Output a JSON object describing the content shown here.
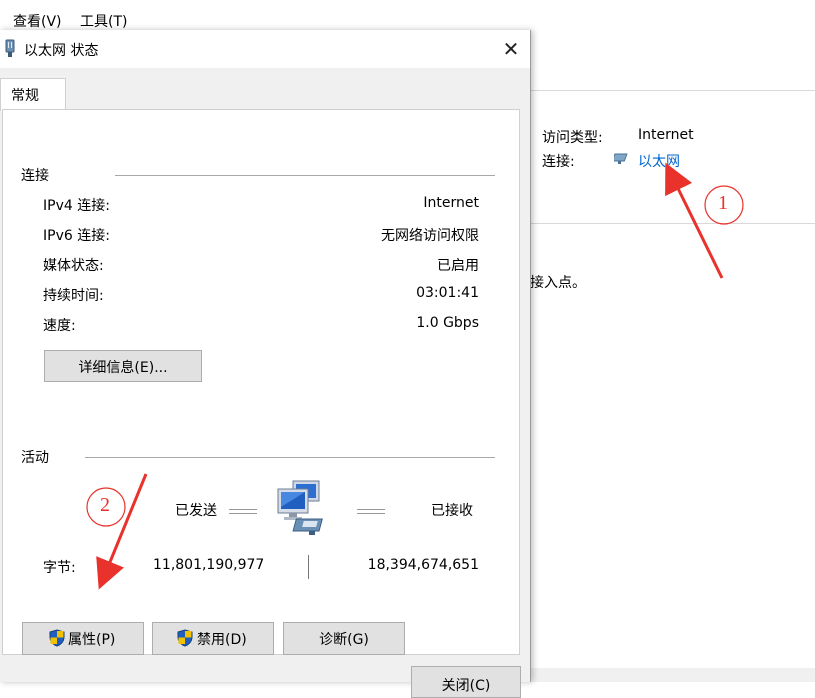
{
  "menu": {
    "view": "查看(V)",
    "tools": "工具(T)"
  },
  "background": {
    "access_type_label": "访问类型:",
    "access_type_value": "Internet",
    "connection_label": "连接:",
    "connection_link": "以太网",
    "partial_text": "接入点。"
  },
  "dialog": {
    "title": "以太网 状态",
    "tab": "常规",
    "connection_section": "连接",
    "rows": [
      {
        "label": "IPv4 连接:",
        "value": "Internet"
      },
      {
        "label": "IPv6 连接:",
        "value": "无网络访问权限"
      },
      {
        "label": "媒体状态:",
        "value": "已启用"
      },
      {
        "label": "持续时间:",
        "value": "03:01:41"
      },
      {
        "label": "速度:",
        "value": "1.0 Gbps"
      }
    ],
    "details_button": "详细信息(E)...",
    "activity_section": "活动",
    "sent_label": "已发送",
    "received_label": "已接收",
    "bytes_label": "字节:",
    "bytes_sent": "11,801,190,977",
    "bytes_received": "18,394,674,651",
    "properties_button": "属性(P)",
    "disable_button": "禁用(D)",
    "diagnose_button": "诊断(G)",
    "close_button": "关闭(C)"
  },
  "annotations": {
    "marker1": "1",
    "marker2": "2"
  },
  "colors": {
    "annotation_red": "#e8322b",
    "link_blue": "#0066cc",
    "shield_blue": "#1f5fbf",
    "shield_yellow": "#f2c200"
  }
}
